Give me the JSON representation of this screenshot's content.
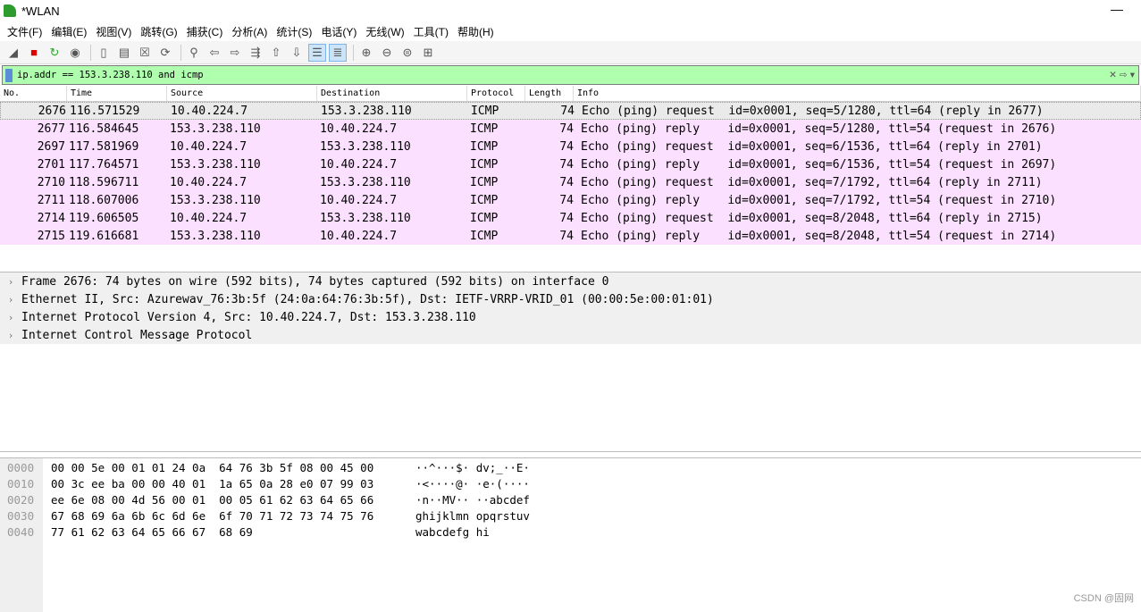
{
  "window": {
    "title": "*WLAN",
    "minimize": "—"
  },
  "menu": [
    "文件(F)",
    "编辑(E)",
    "视图(V)",
    "跳转(G)",
    "捕获(C)",
    "分析(A)",
    "统计(S)",
    "电话(Y)",
    "无线(W)",
    "工具(T)",
    "帮助(H)"
  ],
  "toolbar": [
    "shark-fin-start",
    "stop",
    "restart",
    "options",
    "open",
    "save",
    "close",
    "reload",
    "find",
    "go-back",
    "go-forward",
    "go-to-packet",
    "first-packet",
    "last-packet",
    "auto-scroll",
    "colorize",
    "zoom-in",
    "zoom-out",
    "zoom-normal",
    "resize-columns"
  ],
  "filter": {
    "value": "ip.addr == 153.3.238.110 and icmp",
    "clear": "✕",
    "apply": "⇨",
    "dropdown": "▾"
  },
  "columns": [
    "No.",
    "Time",
    "Source",
    "Destination",
    "Protocol",
    "Length",
    "Info"
  ],
  "packets": [
    [
      "2676",
      "116.571529",
      "10.40.224.7",
      "153.3.238.110",
      "ICMP",
      "74",
      "Echo (ping) request  id=0x0001, seq=5/1280, ttl=64 (reply in 2677)"
    ],
    [
      "2677",
      "116.584645",
      "153.3.238.110",
      "10.40.224.7",
      "ICMP",
      "74",
      "Echo (ping) reply    id=0x0001, seq=5/1280, ttl=54 (request in 2676)"
    ],
    [
      "2697",
      "117.581969",
      "10.40.224.7",
      "153.3.238.110",
      "ICMP",
      "74",
      "Echo (ping) request  id=0x0001, seq=6/1536, ttl=64 (reply in 2701)"
    ],
    [
      "2701",
      "117.764571",
      "153.3.238.110",
      "10.40.224.7",
      "ICMP",
      "74",
      "Echo (ping) reply    id=0x0001, seq=6/1536, ttl=54 (request in 2697)"
    ],
    [
      "2710",
      "118.596711",
      "10.40.224.7",
      "153.3.238.110",
      "ICMP",
      "74",
      "Echo (ping) request  id=0x0001, seq=7/1792, ttl=64 (reply in 2711)"
    ],
    [
      "2711",
      "118.607006",
      "153.3.238.110",
      "10.40.224.7",
      "ICMP",
      "74",
      "Echo (ping) reply    id=0x0001, seq=7/1792, ttl=54 (request in 2710)"
    ],
    [
      "2714",
      "119.606505",
      "10.40.224.7",
      "153.3.238.110",
      "ICMP",
      "74",
      "Echo (ping) request  id=0x0001, seq=8/2048, ttl=64 (reply in 2715)"
    ],
    [
      "2715",
      "119.616681",
      "153.3.238.110",
      "10.40.224.7",
      "ICMP",
      "74",
      "Echo (ping) reply    id=0x0001, seq=8/2048, ttl=54 (request in 2714)"
    ]
  ],
  "details": [
    "Frame 2676: 74 bytes on wire (592 bits), 74 bytes captured (592 bits) on interface 0",
    "Ethernet II, Src: Azurewav_76:3b:5f (24:0a:64:76:3b:5f), Dst: IETF-VRRP-VRID_01 (00:00:5e:00:01:01)",
    "Internet Protocol Version 4, Src: 10.40.224.7, Dst: 153.3.238.110",
    "Internet Control Message Protocol"
  ],
  "hex": [
    [
      "0000",
      "00 00 5e 00 01 01 24 0a  64 76 3b 5f 08 00 45 00",
      "··^···$· dv;_··E·"
    ],
    [
      "0010",
      "00 3c ee ba 00 00 40 01  1a 65 0a 28 e0 07 99 03",
      "·<····@· ·e·(····"
    ],
    [
      "0020",
      "ee 6e 08 00 4d 56 00 01  00 05 61 62 63 64 65 66",
      "·n··MV·· ··abcdef"
    ],
    [
      "0030",
      "67 68 69 6a 6b 6c 6d 6e  6f 70 71 72 73 74 75 76",
      "ghijklmn opqrstuv"
    ],
    [
      "0040",
      "77 61 62 63 64 65 66 67  68 69",
      "wabcdefg hi"
    ]
  ],
  "watermark": "CSDN @固网",
  "colors": {
    "icmp_row": "#fce0ff",
    "filter_bg": "#afffaf",
    "selected_row": "#eaeaea"
  }
}
